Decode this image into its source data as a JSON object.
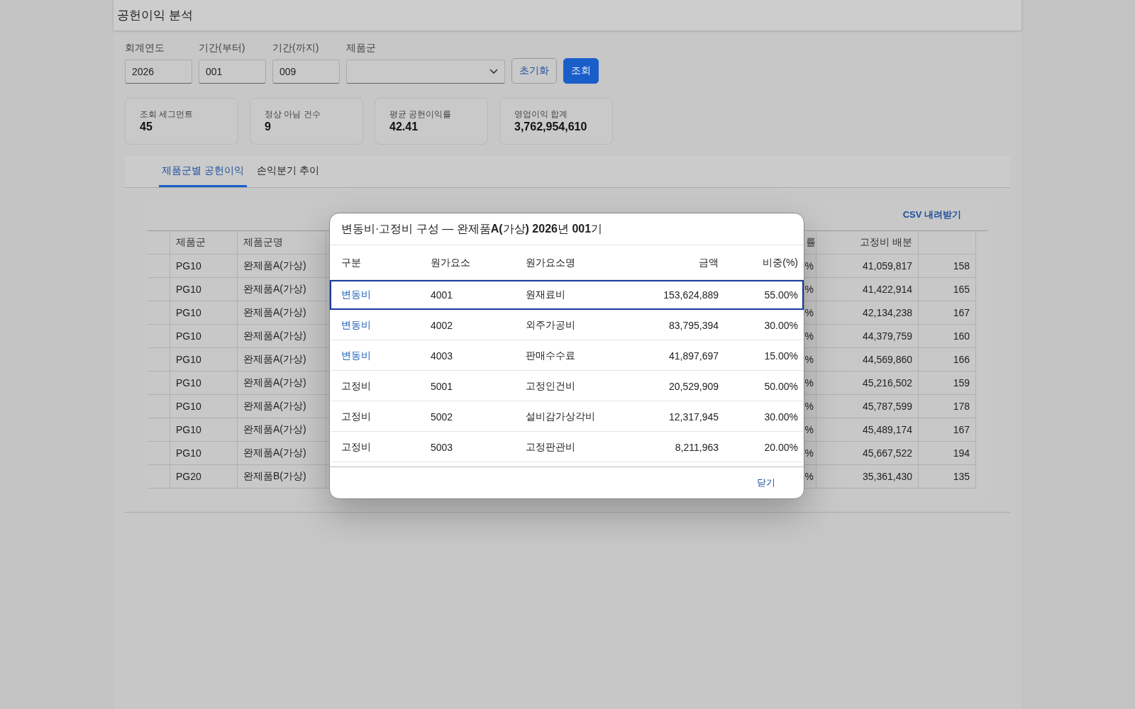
{
  "page_title": "공헌이익 분석",
  "filters": [
    {
      "label": "회계연도",
      "value": "2026",
      "kind": "text"
    },
    {
      "label": "기간(부터)",
      "value": "001",
      "kind": "text"
    },
    {
      "label": "기간(까지)",
      "value": "009",
      "kind": "text"
    },
    {
      "label": "제품군",
      "kind": "select"
    }
  ],
  "buttons": [
    {
      "label": "초기화",
      "kind": "secondary"
    },
    {
      "label": "조회",
      "kind": "primary"
    }
  ],
  "kpis": [
    {
      "label": "조회 세그먼트",
      "value": "45"
    },
    {
      "label": "정상 아님 건수",
      "value": "9"
    },
    {
      "label": "평균 공헌이익률",
      "value": "42.41"
    },
    {
      "label": "영업이익 합계",
      "value": "3,762,954,610"
    }
  ],
  "tabs": [
    {
      "label": "제품군별 공헌이익",
      "selected": true
    },
    {
      "label": "손익분기 추이",
      "selected": false
    }
  ],
  "table": {
    "csv_link": "CSV 내려받기",
    "columns": [
      null,
      "제품군",
      "제품군명",
      "률",
      "고정비 배분",
      null
    ],
    "rows": [
      [
        null,
        "PG10",
        "완제품A(가상)",
        "%",
        "41,059,817",
        "158"
      ],
      [
        null,
        "PG10",
        "완제품A(가상)",
        "%",
        "41,422,914",
        "165"
      ],
      [
        null,
        "PG10",
        "완제품A(가상)",
        "%",
        "42,134,238",
        "167"
      ],
      [
        null,
        "PG10",
        "완제품A(가상)",
        "%",
        "44,379,759",
        "160"
      ],
      [
        null,
        "PG10",
        "완제품A(가상)",
        "%",
        "44,569,860",
        "166"
      ],
      [
        null,
        "PG10",
        "완제품A(가상)",
        "%",
        "45,216,502",
        "159"
      ],
      [
        null,
        "PG10",
        "완제품A(가상)",
        "%",
        "45,787,599",
        "178"
      ],
      [
        null,
        "PG10",
        "완제품A(가상)",
        "%",
        "45,489,174",
        "167"
      ],
      [
        null,
        "PG10",
        "완제품A(가상)",
        "%",
        "45,667,522",
        "194"
      ],
      [
        null,
        "PG20",
        "완제품B(가상)",
        "%",
        "35,361,430",
        "135"
      ]
    ]
  },
  "dialog": {
    "title": "변동비·고정비 구성 — 완제품**A(**가상**)** **2026**년 **001**기",
    "columns": [
      "구분",
      "원가요소",
      "원가요소명",
      "금액",
      "비중(%)"
    ],
    "rows": [
      {
        "type": "변동비",
        "kind": "variable",
        "code": "4001",
        "name": "원재료비",
        "amount": "153,624,889",
        "share": "55.00%",
        "selected": true
      },
      {
        "type": "변동비",
        "kind": "variable",
        "code": "4002",
        "name": "외주가공비",
        "amount": "83,795,394",
        "share": "30.00%",
        "selected": false
      },
      {
        "type": "변동비",
        "kind": "variable",
        "code": "4003",
        "name": "판매수수료",
        "amount": "41,897,697",
        "share": "15.00%",
        "selected": false
      },
      {
        "type": "고정비",
        "kind": "fixed",
        "code": "5001",
        "name": "고정인건비",
        "amount": "20,529,909",
        "share": "50.00%",
        "selected": false
      },
      {
        "type": "고정비",
        "kind": "fixed",
        "code": "5002",
        "name": "설비감가상각비",
        "amount": "12,317,945",
        "share": "30.00%",
        "selected": false
      },
      {
        "type": "고정비",
        "kind": "fixed",
        "code": "5003",
        "name": "고정판관비",
        "amount": "8,211,963",
        "share": "20.00%",
        "selected": false
      }
    ],
    "close": "닫기"
  }
}
